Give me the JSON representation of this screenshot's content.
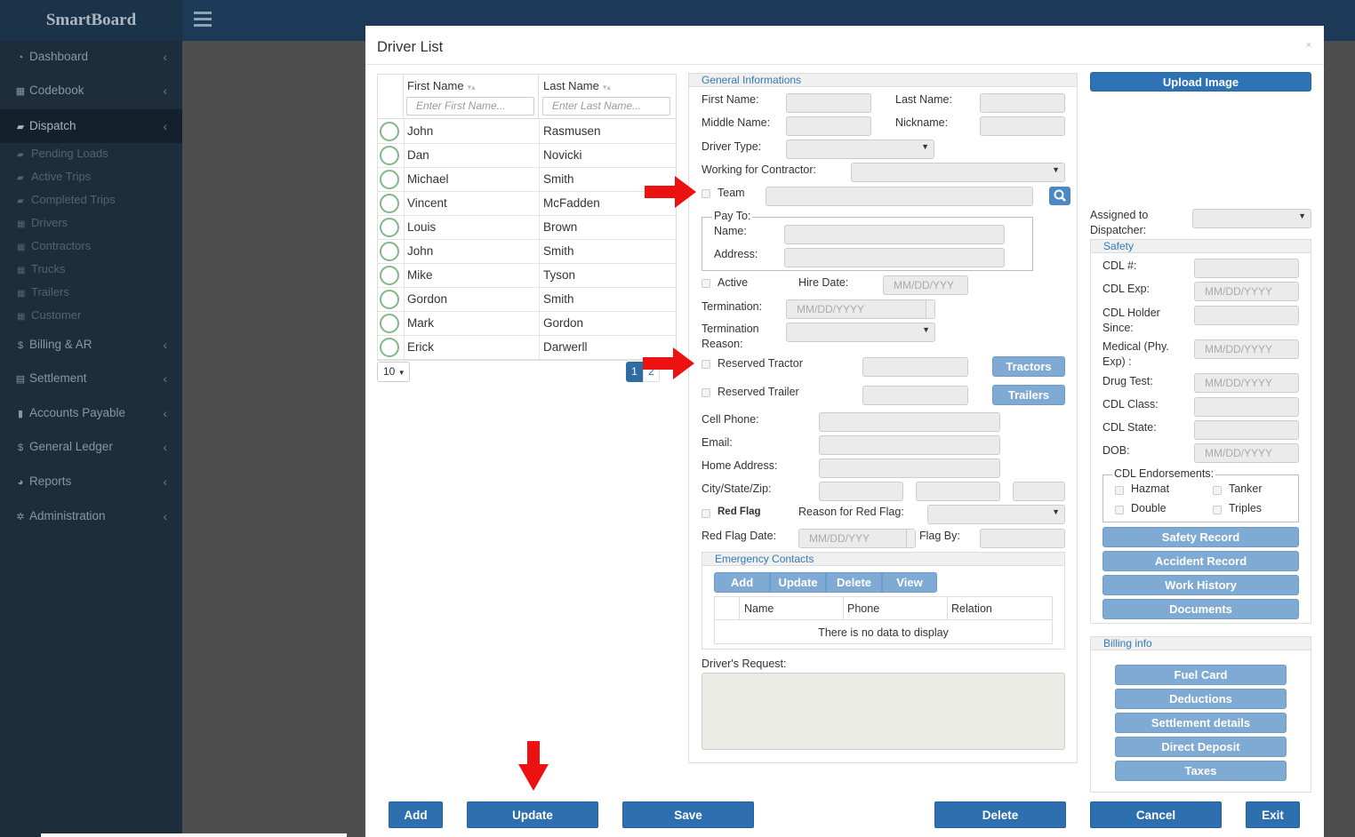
{
  "app": {
    "brand": "SmartBoard"
  },
  "sidebar": {
    "items": [
      {
        "label": "Dashboard",
        "icon": "dashboard-icon",
        "glyph": "◔"
      },
      {
        "label": "Codebook",
        "icon": "grid-icon",
        "glyph": "▦"
      },
      {
        "label": "Dispatch",
        "icon": "truck-icon",
        "glyph": "▰"
      },
      {
        "label": "Billing & AR",
        "icon": "dollar-icon",
        "glyph": "$"
      },
      {
        "label": "Settlement",
        "icon": "table-icon",
        "glyph": "▤"
      },
      {
        "label": "Accounts Payable",
        "icon": "book-icon",
        "glyph": "▮"
      },
      {
        "label": "General Ledger",
        "icon": "dollar-icon",
        "glyph": "$"
      },
      {
        "label": "Reports",
        "icon": "pie-icon",
        "glyph": "◕"
      },
      {
        "label": "Administration",
        "icon": "gears-icon",
        "glyph": "✲"
      }
    ],
    "dispatch_sub": [
      {
        "label": "Pending Loads",
        "glyph": "▰"
      },
      {
        "label": "Active Trips",
        "glyph": "▰"
      },
      {
        "label": "Completed Trips",
        "glyph": "▰"
      },
      {
        "label": "Drivers",
        "glyph": "▦"
      },
      {
        "label": "Contractors",
        "glyph": "▦"
      },
      {
        "label": "Trucks",
        "glyph": "▦"
      },
      {
        "label": "Trailers",
        "glyph": "▦"
      },
      {
        "label": "Customer",
        "glyph": "▦"
      }
    ]
  },
  "modal": {
    "title": "Driver List",
    "close": "×",
    "grid": {
      "col_first": "First Name",
      "col_last": "Last Name",
      "filter_first_ph": "Enter First Name...",
      "filter_last_ph": "Enter Last Name...",
      "rows": [
        {
          "first": "John",
          "last": "Rasmusen"
        },
        {
          "first": "Dan",
          "last": "Novicki"
        },
        {
          "first": "Michael",
          "last": "Smith"
        },
        {
          "first": "Vincent",
          "last": "McFadden"
        },
        {
          "first": "Louis",
          "last": "Brown"
        },
        {
          "first": "John",
          "last": "Smith"
        },
        {
          "first": "Mike",
          "last": "Tyson"
        },
        {
          "first": "Gordon",
          "last": "Smith"
        },
        {
          "first": "Mark",
          "last": "Gordon"
        },
        {
          "first": "Erick",
          "last": "Darwerll"
        }
      ],
      "page_size": "10",
      "page_current": "1",
      "page_next": "2"
    },
    "general": {
      "header": "General Informations",
      "first_name": "First Name:",
      "last_name": "Last Name:",
      "middle_name": "Middle Name:",
      "nickname": "Nickname:",
      "driver_type": "Driver Type:",
      "working_for": "Working for Contractor:",
      "team": "Team",
      "pay_to": "Pay To:",
      "pay_name": "Name:",
      "pay_address": "Address:",
      "active": "Active",
      "hire_date": "Hire Date:",
      "date_ph": "MM/DD/YYY",
      "termination": "Termination:",
      "date_ph_full": "MM/DD/YYYY",
      "termination_reason_1": "Termination",
      "termination_reason_2": "Reason:",
      "reserved_tractor": "Reserved Tractor",
      "tractors_btn": "Tractors",
      "reserved_trailer": "Reserved Trailer",
      "trailers_btn": "Trailers",
      "cell_phone": "Cell Phone:",
      "email": "Email:",
      "home_address": "Home Address:",
      "city_state_zip": "City/State/Zip:",
      "red_flag": "Red Flag",
      "reason_red_flag": "Reason for Red Flag:",
      "red_flag_date": "Red Flag Date:",
      "flag_by": "Flag By:"
    },
    "emergency": {
      "header": "Emergency Contacts",
      "add": "Add",
      "update": "Update",
      "delete": "Delete",
      "view": "View",
      "col_name": "Name",
      "col_phone": "Phone",
      "col_relation": "Relation",
      "empty": "There is no data to display"
    },
    "drivers_request": "Driver's Request:",
    "right": {
      "upload": "Upload Image",
      "assigned_1": "Assigned to",
      "assigned_2": "Dispatcher:",
      "safety": "Safety",
      "cdl_num": "CDL #:",
      "cdl_exp": "CDL Exp:",
      "cdl_holder_1": "CDL Holder",
      "cdl_holder_2": "Since:",
      "medical_1": "Medical (Phy.",
      "medical_2": "Exp) :",
      "drug_test": "Drug Test:",
      "cdl_class": "CDL Class:",
      "cdl_state": "CDL State:",
      "dob": "DOB:",
      "date_ph": "MM/DD/YYYY",
      "endorsements": "CDL Endorsements:",
      "hazmat": "Hazmat",
      "tanker": "Tanker",
      "double": "Double",
      "triples": "Triples",
      "safety_record": "Safety Record",
      "accident_record": "Accident Record",
      "work_history": "Work History",
      "documents": "Documents",
      "billing": "Billing info",
      "fuel_card": "Fuel Card",
      "deductions": "Deductions",
      "settlement": "Settlement details",
      "direct_deposit": "Direct Deposit",
      "taxes": "Taxes"
    },
    "footer": {
      "add": "Add",
      "update": "Update",
      "save": "Save",
      "delete": "Delete",
      "cancel": "Cancel",
      "exit": "Exit"
    }
  },
  "colors": {
    "sidebar": "#1d2d3c",
    "topbar": "#1c3a57",
    "primary": "#2e73b5",
    "light_btn": "#7faad4",
    "arrow": "#ee1111"
  }
}
